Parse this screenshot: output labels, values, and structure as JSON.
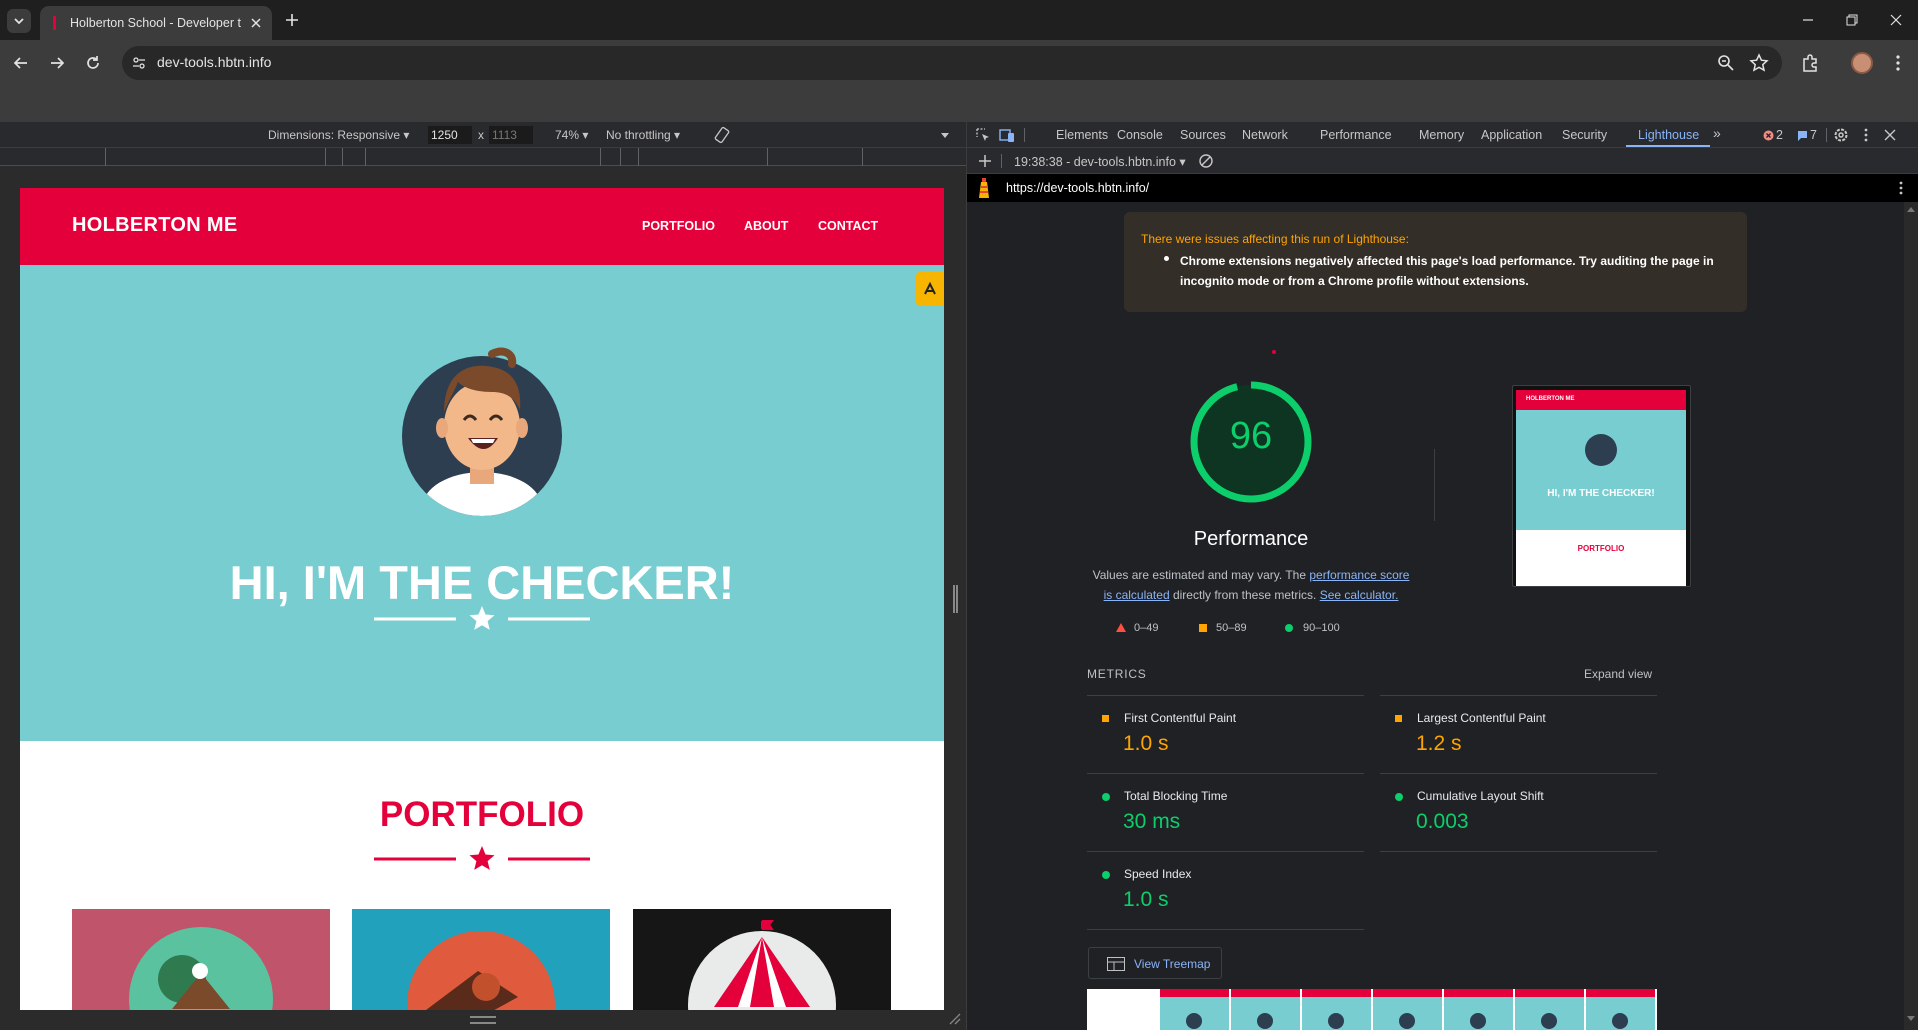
{
  "browser": {
    "tab_title": "Holberton School - Developer t",
    "url": "dev-tools.hbtn.info"
  },
  "device_toolbar": {
    "dimensions_label": "Dimensions: Responsive",
    "width": "1250",
    "x_sep": "x",
    "height": "1113",
    "zoom": "74%",
    "throttling": "No throttling"
  },
  "site": {
    "brand": "HOLBERTON ME",
    "nav": [
      "PORTFOLIO",
      "ABOUT",
      "CONTACT"
    ],
    "hero_title": "HI, I'M THE CHECKER!",
    "section_title": "PORTFOLIO"
  },
  "devtools": {
    "tabs": [
      "Elements",
      "Console",
      "Sources",
      "Network",
      "Performance",
      "Memory",
      "Application",
      "Security",
      "Lighthouse"
    ],
    "active_tab": "Lighthouse",
    "errors": "2",
    "messages": "7",
    "report_selector": "19:38:38 - dev-tools.hbtn.info",
    "report_url": "https://dev-tools.hbtn.info/"
  },
  "lighthouse": {
    "warning_title": "There were issues affecting this run of Lighthouse:",
    "warning_item": "Chrome extensions negatively affected this page's load performance. Try auditing the page in incognito mode or from a Chrome profile without extensions.",
    "score": "96",
    "score_fraction": 0.96,
    "category": "Performance",
    "desc_1": "Values are estimated and may vary. The",
    "desc_link_1": "performance score is calculated",
    "desc_2": "directly from these metrics.",
    "desc_link_2": "See calculator.",
    "legend": [
      "0–49",
      "50–89",
      "90–100"
    ],
    "metrics_heading": "METRICS",
    "expand_view": "Expand view",
    "metrics": [
      {
        "label": "First Contentful Paint",
        "value": "1.0 s",
        "status": "average"
      },
      {
        "label": "Largest Contentful Paint",
        "value": "1.2 s",
        "status": "average"
      },
      {
        "label": "Total Blocking Time",
        "value": "30 ms",
        "status": "pass"
      },
      {
        "label": "Cumulative Layout Shift",
        "value": "0.003",
        "status": "pass"
      },
      {
        "label": "Speed Index",
        "value": "1.0 s",
        "status": "pass"
      }
    ],
    "treemap_button": "View Treemap",
    "thumb_brand": "HOLBERTON ME",
    "thumb_hero": "HI, I'M THE CHECKER!",
    "thumb_section": "PORTFOLIO"
  },
  "colors": {
    "brand_red": "#e4003a",
    "hero_teal": "#78cdd1",
    "score_green": "#0cce6b",
    "average_orange": "#ffa400",
    "fail_red": "#ff4e42",
    "link_blue": "#8ab4f8"
  }
}
